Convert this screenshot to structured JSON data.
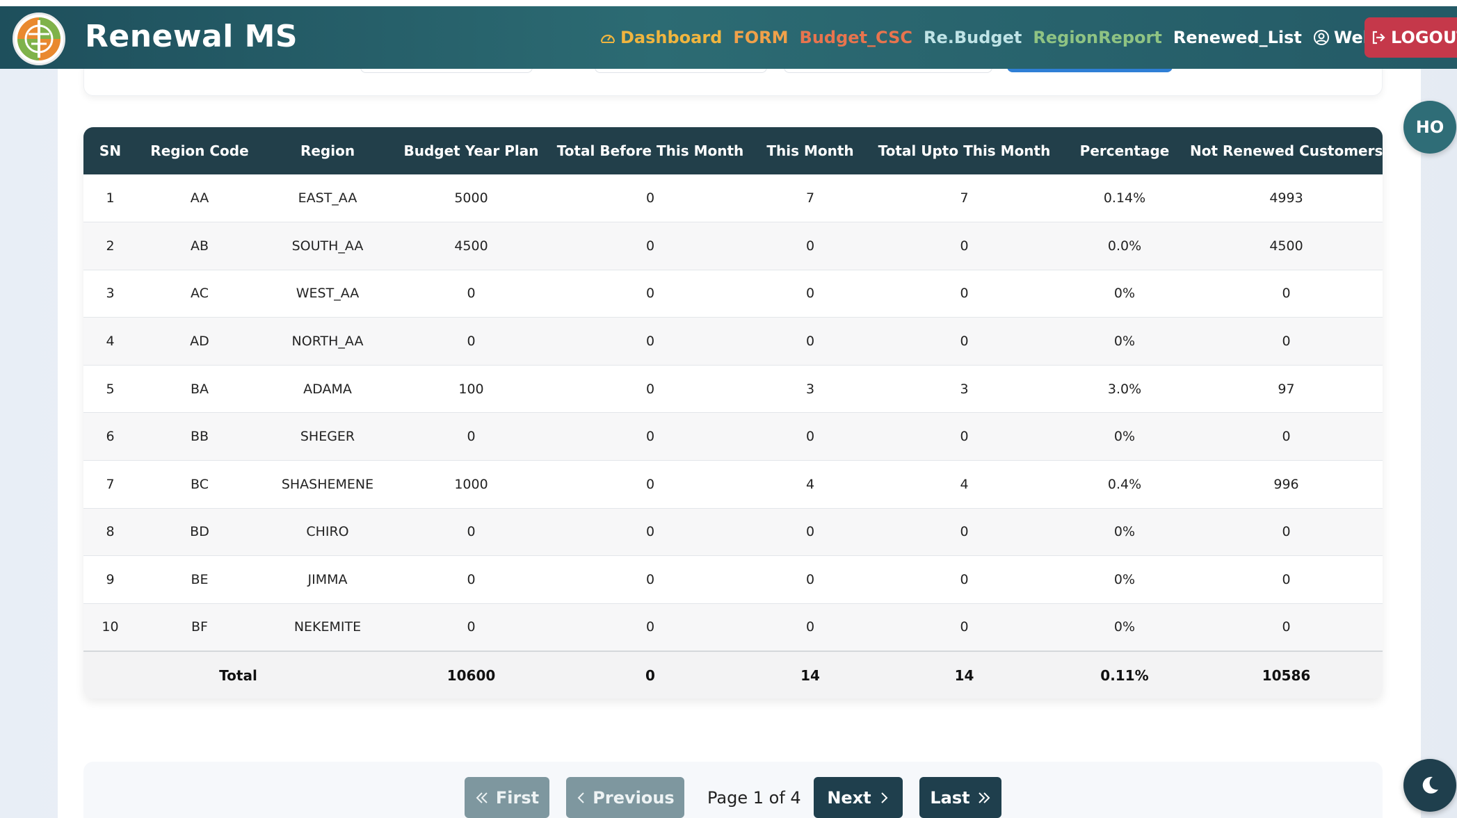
{
  "app": {
    "brand": "Renewal MS"
  },
  "nav": {
    "items": [
      {
        "label": "Dashboard",
        "color": "#f0b53f",
        "icon": "gauge-icon"
      },
      {
        "label": "FORM",
        "color": "#f0a14a",
        "icon": ""
      },
      {
        "label": "Budget_CSC",
        "color": "#e8744e",
        "icon": ""
      },
      {
        "label": "Re.Budget",
        "color": "#bfe3e6",
        "icon": ""
      },
      {
        "label": "RegionReport",
        "color": "#8fc383",
        "icon": ""
      },
      {
        "label": "Renewed_List",
        "color": "#ffffff",
        "icon": ""
      },
      {
        "label": "Welcome, Hagos",
        "color": "#ffffff",
        "icon": "user-circle-icon"
      }
    ],
    "logout_label": "LOGOUT",
    "logout_color": "#c5384a"
  },
  "avatar_initials": "HO",
  "table": {
    "headers": [
      "SN",
      "Region Code",
      "Region",
      "Budget Year Plan",
      "Total Before This Month",
      "This Month",
      "Total Upto This Month",
      "Percentage",
      "Not Renewed Customers"
    ],
    "rows": [
      [
        "1",
        "AA",
        "EAST_AA",
        "5000",
        "0",
        "7",
        "7",
        "0.14%",
        "4993"
      ],
      [
        "2",
        "AB",
        "SOUTH_AA",
        "4500",
        "0",
        "0",
        "0",
        "0.0%",
        "4500"
      ],
      [
        "3",
        "AC",
        "WEST_AA",
        "0",
        "0",
        "0",
        "0",
        "0%",
        "0"
      ],
      [
        "4",
        "AD",
        "NORTH_AA",
        "0",
        "0",
        "0",
        "0",
        "0%",
        "0"
      ],
      [
        "5",
        "BA",
        "ADAMA",
        "100",
        "0",
        "3",
        "3",
        "3.0%",
        "97"
      ],
      [
        "6",
        "BB",
        "SHEGER",
        "0",
        "0",
        "0",
        "0",
        "0%",
        "0"
      ],
      [
        "7",
        "BC",
        "SHASHEMENE",
        "1000",
        "0",
        "4",
        "4",
        "0.4%",
        "996"
      ],
      [
        "8",
        "BD",
        "CHIRO",
        "0",
        "0",
        "0",
        "0",
        "0%",
        "0"
      ],
      [
        "9",
        "BE",
        "JIMMA",
        "0",
        "0",
        "0",
        "0",
        "0%",
        "0"
      ],
      [
        "10",
        "BF",
        "NEKEMITE",
        "0",
        "0",
        "0",
        "0",
        "0%",
        "0"
      ]
    ],
    "total": {
      "label": "Total",
      "budget_year_plan": "10600",
      "total_before": "0",
      "this_month": "14",
      "total_upto": "14",
      "percentage": "0.11%",
      "not_renewed": "10586"
    }
  },
  "pagination": {
    "first_label": "First",
    "previous_label": "Previous",
    "page_info": "Page 1 of 4",
    "next_label": "Next",
    "last_label": "Last"
  },
  "colors": {
    "header_bg": "#223f4a",
    "navbar_start": "#1e4f5c",
    "navbar_end": "#2c6b73",
    "disabled_btn": "#7e979f",
    "active_btn": "#1f3f4d"
  }
}
